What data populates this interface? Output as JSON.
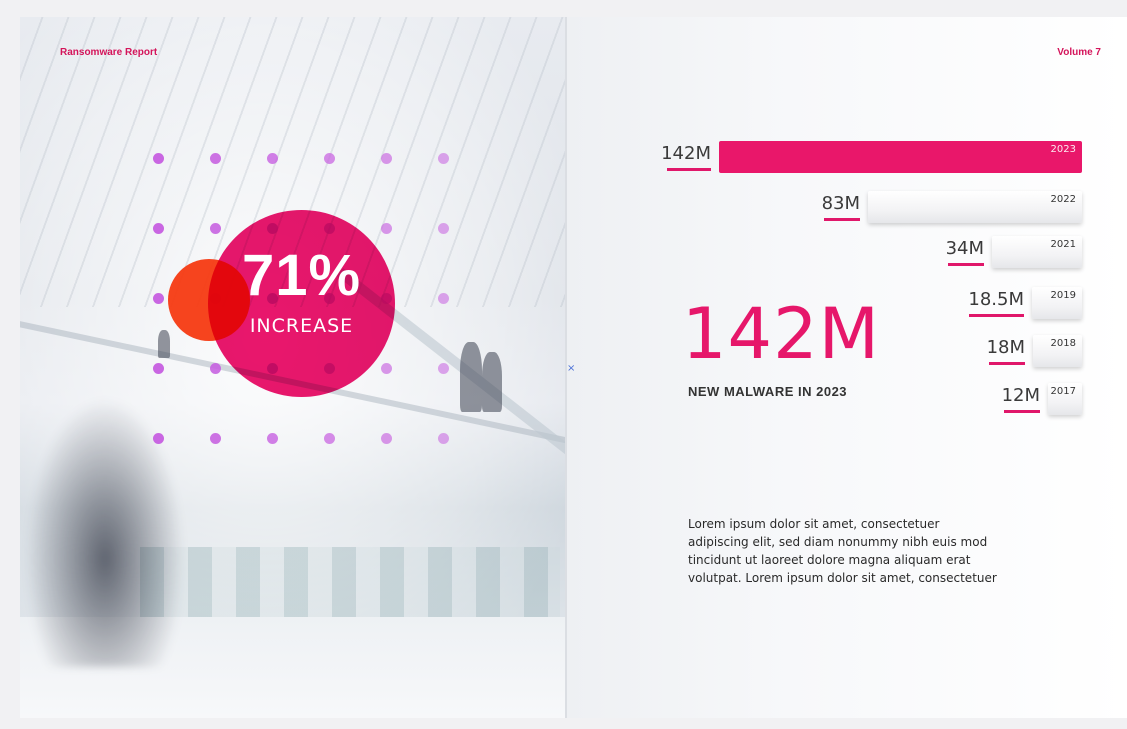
{
  "header": {
    "report_title": "Ransomware Report",
    "volume": "Volume 7"
  },
  "highlight": {
    "percent": "71%",
    "label": "INCREASE"
  },
  "stat": {
    "big_number": "142M",
    "caption": "NEW MALWARE IN 2023"
  },
  "body_text": "Lorem ipsum dolor sit amet, consectetuer adipiscing elit, sed diam nonummy nibh euis mod tincidunt ut laoreet dolore magna aliquam erat volutpat.  Lorem ipsum dolor sit amet, consectetuer",
  "colors": {
    "accent": "#e9176a",
    "accent_orange": "#f53a12",
    "dot": "#c65ee0"
  },
  "chart_data": {
    "type": "bar",
    "orientation": "horizontal",
    "categories": [
      "2023",
      "2022",
      "2021",
      "2019",
      "2018",
      "2017"
    ],
    "values": [
      142,
      83,
      34,
      18.5,
      18,
      12
    ],
    "value_labels": [
      "142M",
      "83M",
      "34M",
      "18.5M",
      "18M",
      "12M"
    ],
    "highlighted_category": "2023"
  }
}
